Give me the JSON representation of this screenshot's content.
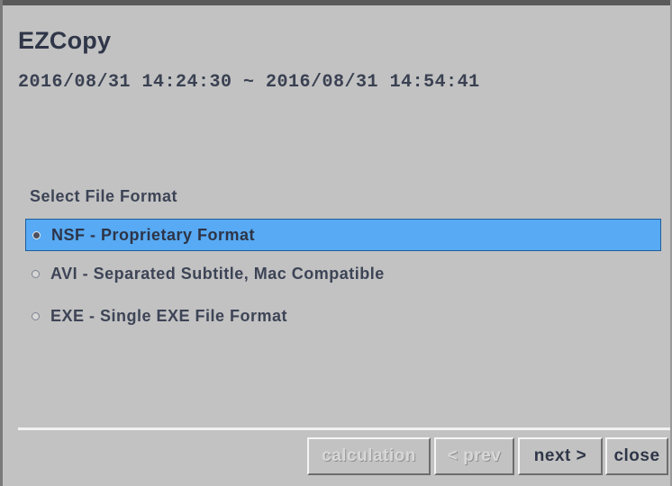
{
  "app": {
    "title": "EZCopy",
    "date_range": "2016/08/31 14:24:30 ~ 2016/08/31 14:54:41"
  },
  "format_section": {
    "label": "Select File Format",
    "options": [
      {
        "label": "NSF - Proprietary Format",
        "selected": true
      },
      {
        "label": "AVI - Separated Subtitle, Mac Compatible",
        "selected": false
      },
      {
        "label": "EXE - Single EXE File Format",
        "selected": false
      }
    ]
  },
  "buttons": {
    "calculation": "calculation",
    "prev": "< prev",
    "next": "next >",
    "close": "close"
  },
  "colors": {
    "background": "#c2c2c2",
    "selection": "#57aaf3",
    "text": "#3d4456"
  }
}
